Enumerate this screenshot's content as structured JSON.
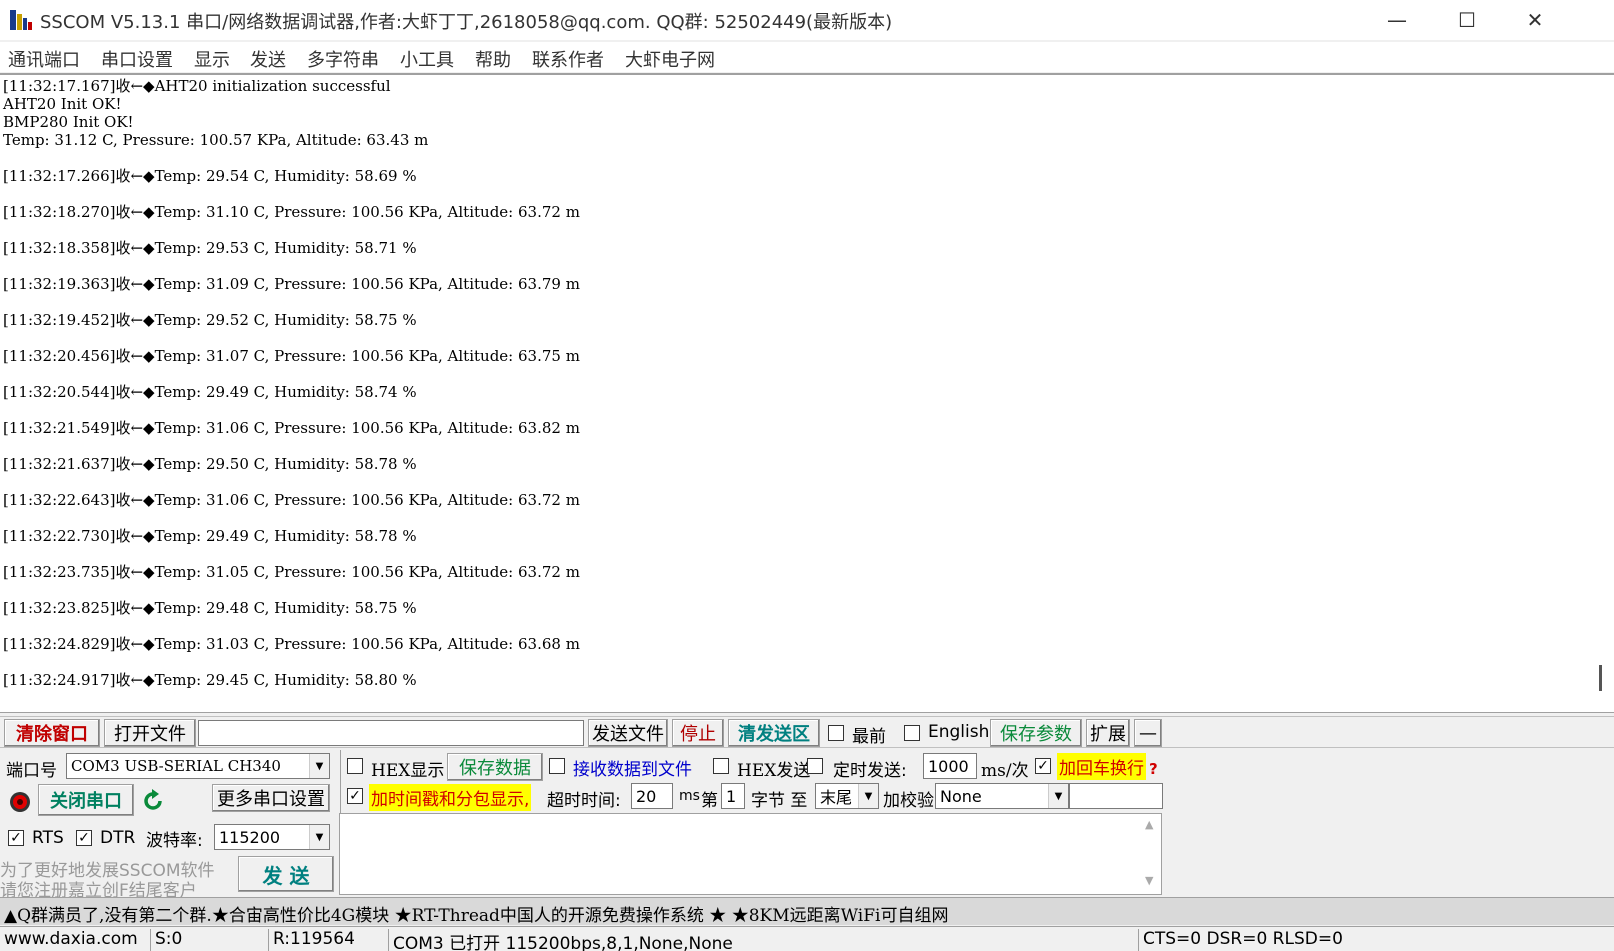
{
  "window": {
    "title": "SSCOM V5.13.1 串口/网络数据调试器,作者:大虾丁丁,2618058@qq.com. QQ群: 52502449(最新版本)",
    "minimize_glyph": "—",
    "maximize_glyph": "☐",
    "close_glyph": "✕"
  },
  "menu": {
    "items": [
      "通讯端口",
      "串口设置",
      "显示",
      "发送",
      "多字符串",
      "小工具",
      "帮助",
      "联系作者",
      "大虾电子网"
    ]
  },
  "receive": {
    "lines": [
      "[11:32:17.167]收←◆AHT20 initialization successful",
      "AHT20 Init OK!",
      "BMP280 Init OK!",
      "Temp: 31.12 C, Pressure: 100.57 KPa, Altitude: 63.43 m",
      "",
      "[11:32:17.266]收←◆Temp: 29.54 C, Humidity: 58.69 %",
      "",
      "[11:32:18.270]收←◆Temp: 31.10 C, Pressure: 100.56 KPa, Altitude: 63.72 m",
      "",
      "[11:32:18.358]收←◆Temp: 29.53 C, Humidity: 58.71 %",
      "",
      "[11:32:19.363]收←◆Temp: 31.09 C, Pressure: 100.56 KPa, Altitude: 63.79 m",
      "",
      "[11:32:19.452]收←◆Temp: 29.52 C, Humidity: 58.75 %",
      "",
      "[11:32:20.456]收←◆Temp: 31.07 C, Pressure: 100.56 KPa, Altitude: 63.75 m",
      "",
      "[11:32:20.544]收←◆Temp: 29.49 C, Humidity: 58.74 %",
      "",
      "[11:32:21.549]收←◆Temp: 31.06 C, Pressure: 100.56 KPa, Altitude: 63.82 m",
      "",
      "[11:32:21.637]收←◆Temp: 29.50 C, Humidity: 58.78 %",
      "",
      "[11:32:22.643]收←◆Temp: 31.06 C, Pressure: 100.56 KPa, Altitude: 63.72 m",
      "",
      "[11:32:22.730]收←◆Temp: 29.49 C, Humidity: 58.78 %",
      "",
      "[11:32:23.735]收←◆Temp: 31.05 C, Pressure: 100.56 KPa, Altitude: 63.72 m",
      "",
      "[11:32:23.825]收←◆Temp: 29.48 C, Humidity: 58.75 %",
      "",
      "[11:32:24.829]收←◆Temp: 31.03 C, Pressure: 100.56 KPa, Altitude: 63.68 m",
      "",
      "[11:32:24.917]收←◆Temp: 29.45 C, Humidity: 58.80 %"
    ]
  },
  "toolbar": {
    "clear_window": "清除窗口",
    "open_file": "打开文件",
    "file_path": "",
    "send_file": "发送文件",
    "stop": "停止",
    "clear_send": "清发送区",
    "topmost": "最前",
    "english": "English",
    "save_params": "保存参数",
    "expand": "扩展",
    "collapse": "—"
  },
  "port": {
    "port_label": "端口号",
    "port_value": "COM3 USB-SERIAL CH340",
    "close_port": "关闭串口",
    "more_settings": "更多串口设置",
    "rts": "RTS",
    "dtr": "DTR",
    "baud_label": "波特率:",
    "baud_value": "115200",
    "ad_line1": "为了更好地发展SSCOM软件",
    "ad_line2": "请您注册嘉立创F结尾客户",
    "send_button": "发 送"
  },
  "options": {
    "hex_display": "HEX显示",
    "save_data": "保存数据",
    "recv_to_file": "接收数据到文件",
    "hex_send": "HEX发送",
    "timed_send": "定时发送:",
    "interval_value": "1000",
    "interval_unit": "ms/次",
    "add_crlf": "加回车换行",
    "add_timestamp": "加时间戳和分包显示,",
    "timeout_label": "超时时间:",
    "timeout_value": "20",
    "timeout_unit": "ms",
    "byte_prefix": "第",
    "byte_index": "1",
    "byte_label": "字节 至",
    "byte_end": "末尾",
    "checksum_label": "加校验",
    "checksum_value": "None",
    "help_glyph": "?"
  },
  "marquee": {
    "text": "▲Q群满员了,没有第二个群.★合宙高性价比4G模块 ★RT-Thread中国人的开源免费操作系统 ★ ★8KM远距离WiFi可自组网"
  },
  "status": {
    "website": "www.daxia.com",
    "sent": "S:0",
    "received": "R:119564",
    "port_state": "COM3 已打开  115200bps,8,1,None,None",
    "signals": "CTS=0 DSR=0 RLSD=0"
  },
  "checks": {
    "topmost": "",
    "english": "",
    "rts": "✓",
    "dtr": "✓",
    "hex_display": "",
    "recv_to_file": "",
    "hex_send": "",
    "timed_send": "",
    "add_crlf": "✓",
    "add_timestamp": "✓"
  },
  "colors": {
    "accent_red": "#c00000",
    "accent_green": "#0a8a3a",
    "highlight_yellow": "#ffff00"
  }
}
